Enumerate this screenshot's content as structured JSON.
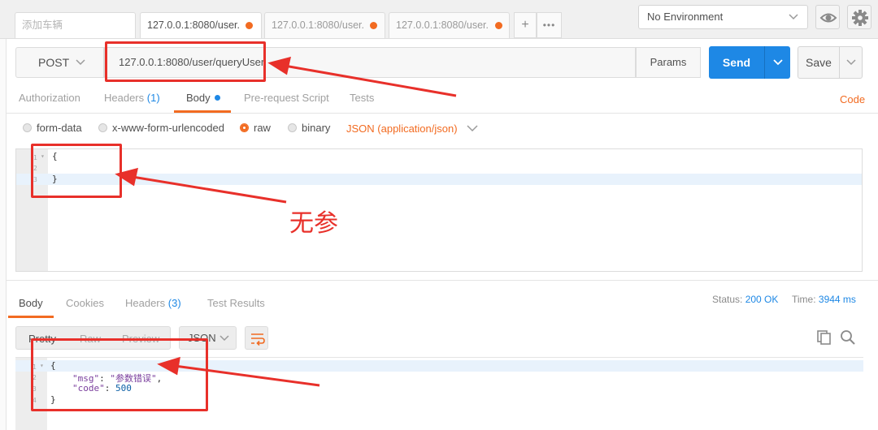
{
  "tabs": {
    "new_tab_placeholder": "添加车辆",
    "items": [
      {
        "label": "127.0.0.1:8080/user."
      },
      {
        "label": "127.0.0.1:8080/user."
      },
      {
        "label": "127.0.0.1:8080/user."
      }
    ],
    "add_icon": "plus-icon",
    "more_icon": "more-horizontal-icon"
  },
  "environment": {
    "selected": "No Environment",
    "eye_icon": "eye-icon",
    "settings_icon": "gear-icon"
  },
  "request": {
    "method": "POST",
    "url": "127.0.0.1:8080/user/queryUser",
    "params_label": "Params",
    "send_label": "Send",
    "save_label": "Save"
  },
  "request_tabs": {
    "authorization": "Authorization",
    "headers": "Headers",
    "headers_count": "(1)",
    "body": "Body",
    "pre_request": "Pre-request Script",
    "tests": "Tests",
    "code": "Code"
  },
  "body_modes": {
    "form_data": "form-data",
    "urlencoded": "x-www-form-urlencoded",
    "raw": "raw",
    "binary": "binary",
    "selected": "raw",
    "content_type": "JSON (application/json)"
  },
  "request_body": {
    "line1": "{",
    "line2": "",
    "line3": "}",
    "ln1": "1",
    "ln2": "2",
    "ln3": "3"
  },
  "annotation_text": "无参",
  "response_tabs": {
    "body": "Body",
    "cookies": "Cookies",
    "headers": "Headers",
    "headers_count": "(3)",
    "test_results": "Test Results"
  },
  "response_meta": {
    "status_label": "Status:",
    "status_value": "200 OK",
    "time_label": "Time:",
    "time_value": "3944 ms"
  },
  "response_toolbar": {
    "pretty": "Pretty",
    "raw": "Raw",
    "preview": "Preview",
    "format": "JSON",
    "wrap_icon": "wrap-lines-icon",
    "copy_icon": "copy-icon",
    "search_icon": "search-icon"
  },
  "response_body": {
    "open": "{",
    "msg_key": "\"msg\"",
    "msg_value": "\"参数错误\"",
    "code_key": "\"code\"",
    "code_value": "500",
    "close": "}",
    "ln1": "1",
    "ln2": "2",
    "ln3": "3",
    "ln4": "4"
  },
  "colors": {
    "accent": "#f26b21",
    "primary": "#1e88e5",
    "annotation": "#e8302a"
  }
}
